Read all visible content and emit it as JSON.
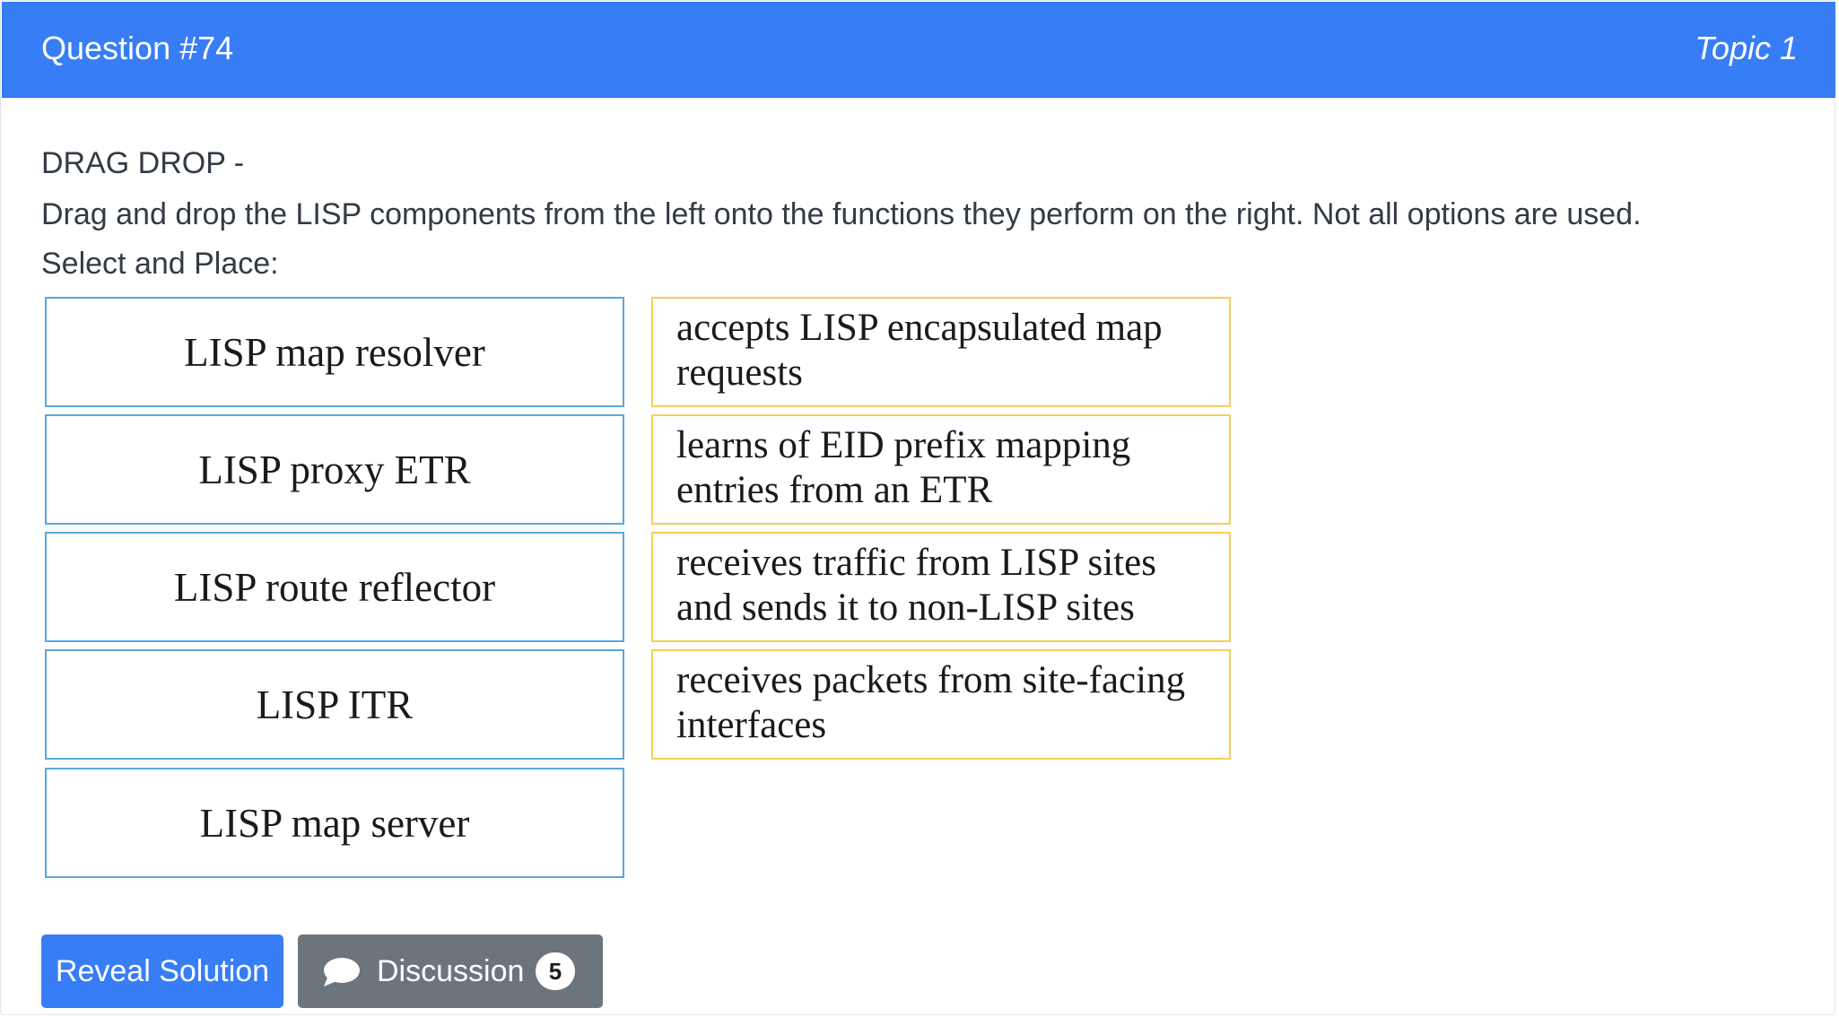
{
  "header": {
    "question_title": "Question #74",
    "topic": "Topic 1"
  },
  "body": {
    "type_label": "DRAG DROP -",
    "instruction": "Drag and drop the LISP components from the left onto the functions they perform on the right. Not all options are used.",
    "select_label": "Select and Place:"
  },
  "exhibit": {
    "components": [
      "LISP map resolver",
      "LISP proxy ETR",
      "LISP route reflector",
      "LISP ITR",
      "LISP map server"
    ],
    "functions": [
      {
        "line1": "accepts LISP encapsulated map",
        "line2": "requests"
      },
      {
        "line1": "learns of EID prefix mapping",
        "line2": "entries from an ETR"
      },
      {
        "line1": "receives traffic from LISP sites",
        "line2": "and sends it to non-LISP sites"
      },
      {
        "line1": "receives packets from site-facing",
        "line2": "interfaces"
      }
    ]
  },
  "actions": {
    "reveal_label": "Reveal Solution",
    "discussion_label": "Discussion",
    "discussion_count": "5"
  },
  "colors": {
    "header_bg": "#377df6",
    "component_border": "#5aa7de",
    "function_border": "#f5cf5c",
    "discussion_bg": "#6c757c"
  },
  "icons": {
    "discussion": "chat-bubble-icon"
  }
}
